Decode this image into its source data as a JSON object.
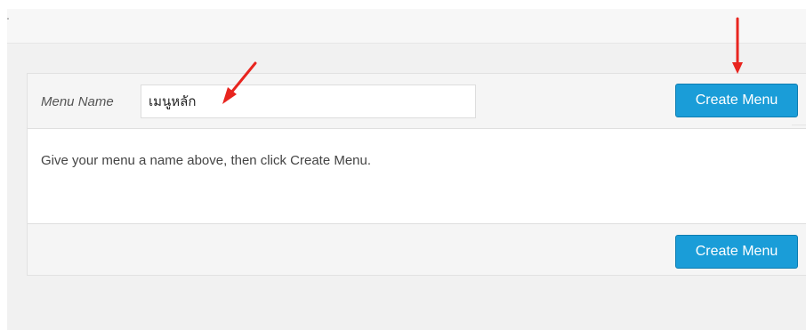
{
  "menu_editor": {
    "menu_name_label": "Menu Name",
    "menu_name_value": "เมนูหลัก",
    "instructions": "Give your menu a name above, then click Create Menu.",
    "create_button_label": "Create Menu"
  },
  "annotations": {
    "arrow_color": "#e8251f",
    "arrow_icon": "red-arrow-icon"
  },
  "colors": {
    "button": "#1a9dd8",
    "button_border": "#0e7db1",
    "page_background": "#f1f1f1"
  }
}
